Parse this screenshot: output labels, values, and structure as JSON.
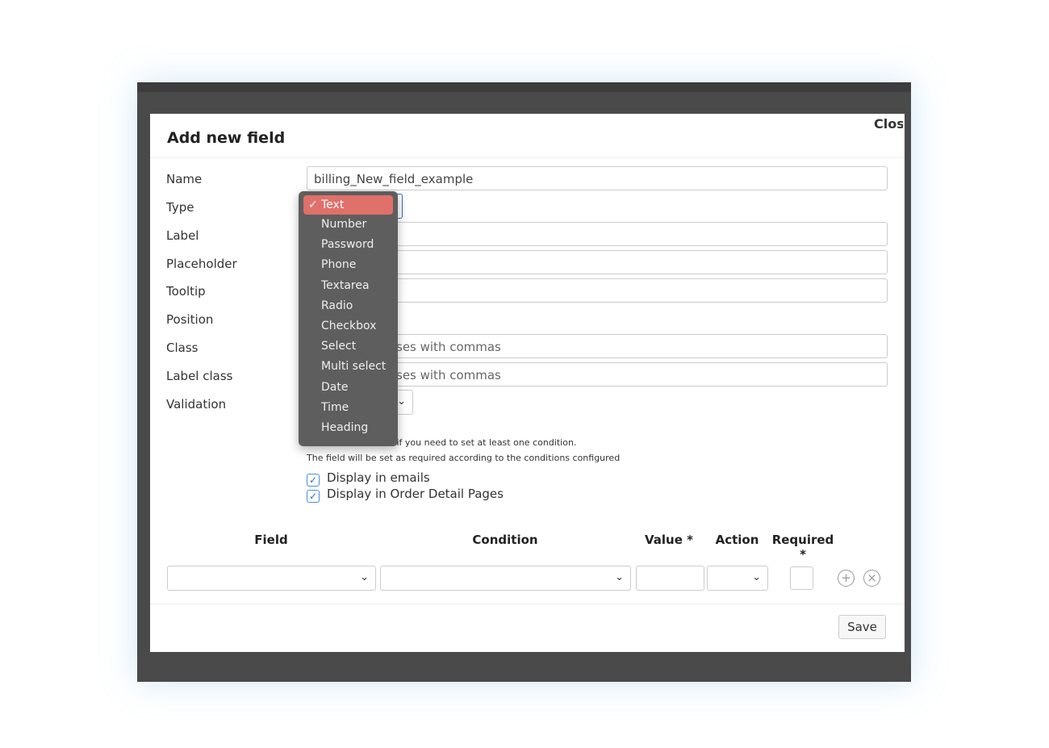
{
  "modal": {
    "title": "Add new field",
    "close_label": "Close",
    "save_label": "Save"
  },
  "form": {
    "labels": [
      "Name",
      "Type",
      "Label",
      "Placeholder",
      "Tooltip",
      "Position",
      "Class",
      "Label class",
      "Validation"
    ],
    "name_value": "billing_New_field_example",
    "class_placeholder_visible": "ses with commas",
    "label_class_placeholder_visible": "ses with commas",
    "note1_visible": "d if you need to set at least one condition.",
    "note2": "The field will be set as required according to the conditions configured",
    "display_emails": "Display in emails",
    "display_order": "Display in Order Detail Pages"
  },
  "type_dropdown": {
    "selected": "Text",
    "options": [
      "Text",
      "Number",
      "Password",
      "Phone",
      "Textarea",
      "Radio",
      "Checkbox",
      "Select",
      "Multi select",
      "Date",
      "Time",
      "Heading"
    ]
  },
  "conditions": {
    "headers": [
      "Field",
      "Condition",
      "Value *",
      "Action",
      "Required *"
    ]
  },
  "colors": {
    "selected_option": "#e0706a",
    "checkbox": "#2d6fc1"
  }
}
